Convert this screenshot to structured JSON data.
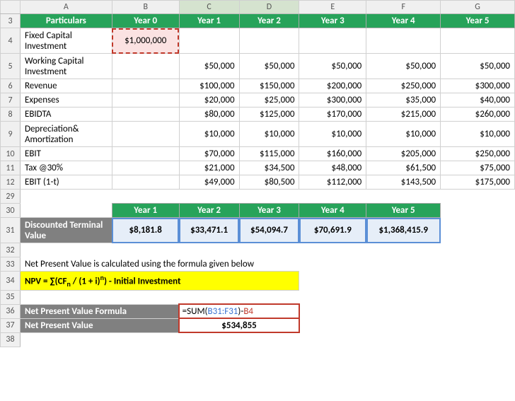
{
  "cols": [
    "A",
    "B",
    "C",
    "D",
    "E",
    "F",
    "G"
  ],
  "selCols": [
    "C",
    "D"
  ],
  "t1": {
    "r3": [
      "Particulars",
      "Year 0",
      "Year 1",
      "Year 2",
      "Year 3",
      "Year 4",
      "Year 5"
    ],
    "rows": [
      {
        "n": "4",
        "label": "Fixed Capital Investment",
        "b": "$1,000,000",
        "c": "",
        "d": "",
        "e": "",
        "f": "",
        "g": "",
        "tall": true,
        "fci": true
      },
      {
        "n": "5",
        "label": "Working Capital Investment",
        "b": "",
        "c": "$50,000",
        "d": "$50,000",
        "e": "$50,000",
        "f": "$50,000",
        "g": "$50,000",
        "tall": true
      },
      {
        "n": "6",
        "label": "Revenue",
        "b": "",
        "c": "$100,000",
        "d": "$150,000",
        "e": "$200,000",
        "f": "$250,000",
        "g": "$300,000"
      },
      {
        "n": "7",
        "label": "Expenses",
        "b": "",
        "c": "$20,000",
        "d": "$25,000",
        "e": "$300,000",
        "f": "$35,000",
        "g": "$40,000"
      },
      {
        "n": "8",
        "label": "EBIDTA",
        "b": "",
        "c": "$80,000",
        "d": "$125,000",
        "e": "$170,000",
        "f": "$215,000",
        "g": "$260,000"
      },
      {
        "n": "9",
        "label": "Depreciation& Amortization",
        "b": "",
        "c": "$10,000",
        "d": "$10,000",
        "e": "$10,000",
        "f": "$10,000",
        "g": "$10,000",
        "tall": true
      },
      {
        "n": "10",
        "label": "EBIT",
        "b": "",
        "c": "$70,000",
        "d": "$115,000",
        "e": "$160,000",
        "f": "$205,000",
        "g": "$250,000"
      },
      {
        "n": "11",
        "label": "Tax @30%",
        "b": "",
        "c": "$21,000",
        "d": "$34,500",
        "e": "$48,000",
        "f": "$61,500",
        "g": "$75,000"
      },
      {
        "n": "12",
        "label": "EBIT (1-t)",
        "b": "",
        "c": "$49,000",
        "d": "$80,500",
        "e": "$112,000",
        "f": "$143,500",
        "g": "$175,000"
      }
    ]
  },
  "t2": {
    "r30": [
      "Year 1",
      "Year 2",
      "Year 3",
      "Year 4",
      "Year 5"
    ],
    "r31lbl": "Discounted Terminal Value",
    "r31": [
      "$8,181.8",
      "$33,471.1",
      "$54,094.7",
      "$70,691.9",
      "$1,368,415.9"
    ]
  },
  "r33": "Net Present Value is calculated using the formula given below",
  "r34_prefix": "NPV = ∑(CF",
  "r34_sub1": "n",
  "r34_mid": " / (1 + i)",
  "r34_sup": "n",
  "r34_end": ") - Initial Investment",
  "r36lbl": "Net Present Value Formula",
  "r36f_eq": "=",
  "r36f_fn": "SUM(",
  "r36f_rng": "B31:F31",
  "r36f_cp": ")",
  "r36f_minus": "-",
  "r36f_ref": "B4",
  "r37lbl": "Net Present Value",
  "r37val": "$534,855",
  "rownums": {
    "r29": "29",
    "r30": "30",
    "r31": "31",
    "r32": "32",
    "r33": "33",
    "r34": "34",
    "r35": "35",
    "r36": "36",
    "r37": "37",
    "r38": "38"
  }
}
